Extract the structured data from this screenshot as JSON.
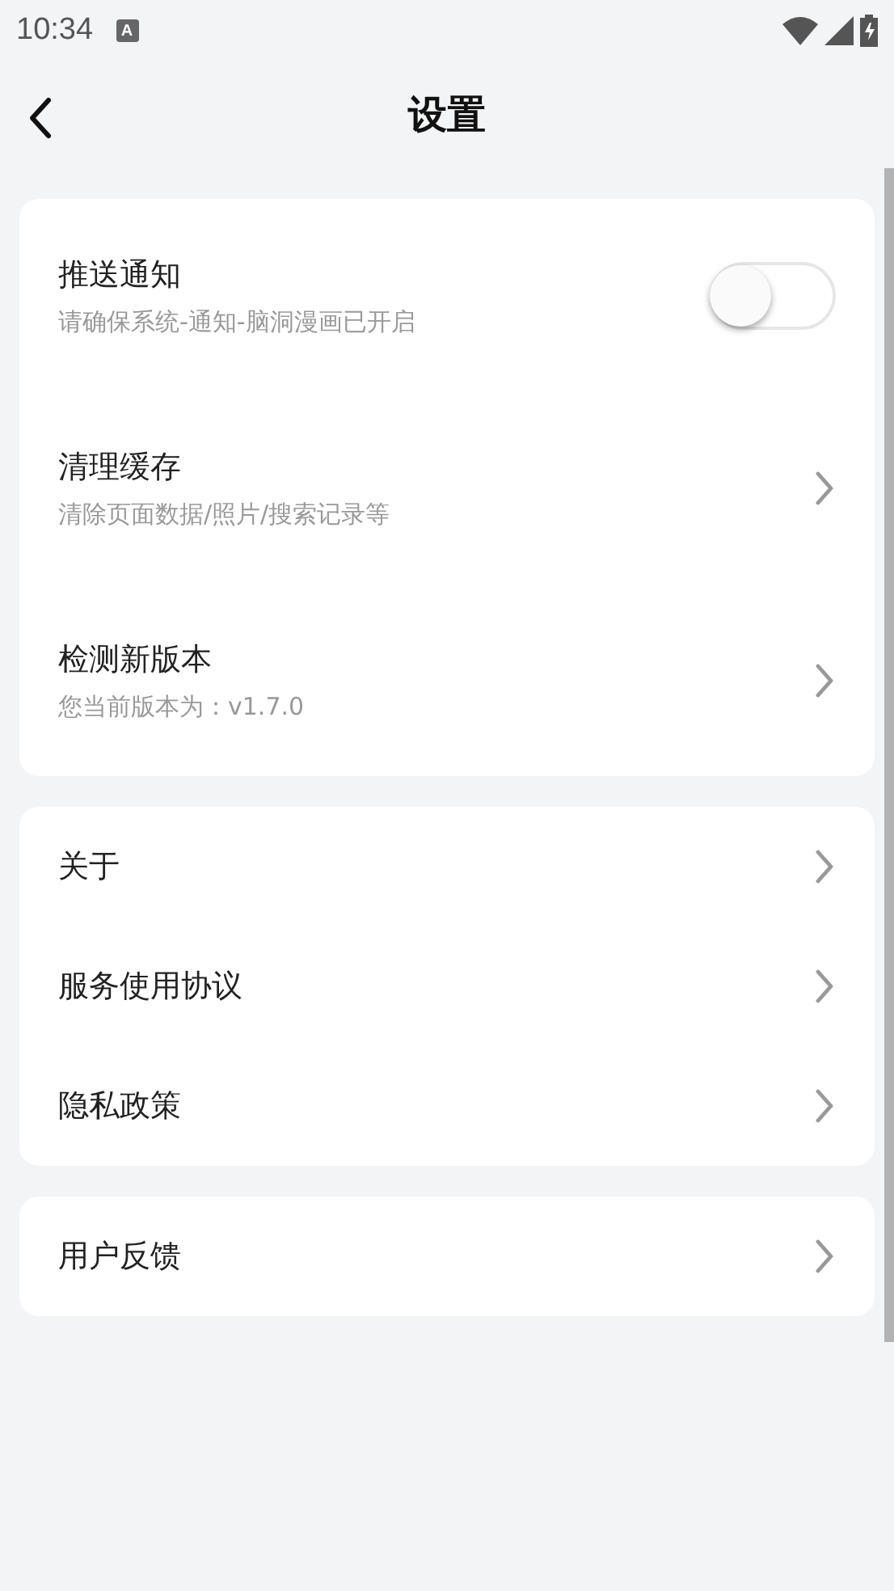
{
  "status_bar": {
    "time": "10:34",
    "notification_badge": "A"
  },
  "header": {
    "title": "设置"
  },
  "groups": [
    {
      "items": [
        {
          "kind": "toggle",
          "title": "推送通知",
          "subtitle": "请确保系统-通知-脑洞漫画已开启",
          "on": false
        },
        {
          "kind": "link",
          "title": "清理缓存",
          "subtitle": "清除页面数据/照片/搜索记录等"
        },
        {
          "kind": "link",
          "title": "检测新版本",
          "subtitle": "您当前版本为：v1.7.0"
        }
      ]
    },
    {
      "items": [
        {
          "kind": "link",
          "title": "关于"
        },
        {
          "kind": "link",
          "title": "服务使用协议"
        },
        {
          "kind": "link",
          "title": "隐私政策"
        }
      ]
    },
    {
      "items": [
        {
          "kind": "link",
          "title": "用户反馈"
        }
      ]
    }
  ]
}
